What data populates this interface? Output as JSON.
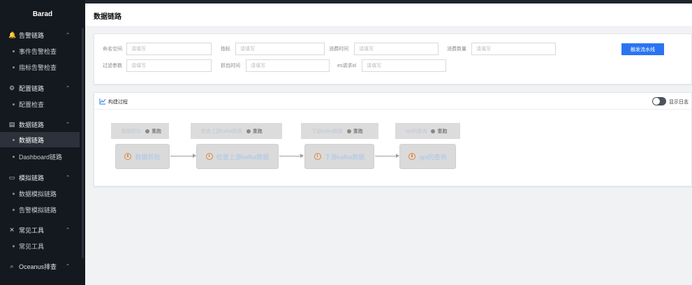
{
  "brand": "Barad",
  "sidebar": {
    "groups": [
      {
        "icon": "bell-icon",
        "glyph": "🔔",
        "label": "告警链路",
        "items": [
          "事件告警检查",
          "指标告警检查"
        ]
      },
      {
        "icon": "sliders-icon",
        "glyph": "⚙",
        "label": "配置链路",
        "items": [
          "配置检查"
        ]
      },
      {
        "icon": "document-icon",
        "glyph": "▤",
        "label": "数据链路",
        "items": [
          "数据链路",
          "Dashboard链路"
        ]
      },
      {
        "icon": "monitor-icon",
        "glyph": "▭",
        "label": "模拟链路",
        "items": [
          "数据模拟链路",
          "告警模拟链路"
        ]
      },
      {
        "icon": "tools-icon",
        "glyph": "✕",
        "label": "常见工具",
        "items": [
          "常见工具"
        ]
      },
      {
        "icon": "search-icon",
        "glyph": "⌕",
        "label": "Oceanus排查",
        "items": []
      }
    ],
    "active_item": "数据链路"
  },
  "page_title": "数据链路",
  "filters": {
    "namespace": {
      "label": "命名空间",
      "placeholder": "请填写"
    },
    "metric": {
      "label": "指标",
      "placeholder": "请填写"
    },
    "consume_time": {
      "label": "消费时间",
      "placeholder": "请填写"
    },
    "consume_count": {
      "label": "消费数量",
      "placeholder": "请填写"
    },
    "filter_params": {
      "label": "过滤参数",
      "placeholder": "请填写"
    },
    "capture_time": {
      "label": "抓包时间",
      "placeholder": "请填写"
    },
    "es_request_id": {
      "label": "es请求id",
      "placeholder": "请填写"
    },
    "trigger_button": "触发流水线"
  },
  "build": {
    "title": "构建过程",
    "toggle_label": "显示日志",
    "toggle_on": false,
    "stages": [
      {
        "status_name": "数据抓包",
        "status_text": "重跑",
        "node_label": "数据抓包"
      },
      {
        "status_name": "检查上游kafka数据",
        "status_text": "重跑",
        "node_label": "检查上游kafka数据"
      },
      {
        "status_name": "下游kafka数据",
        "status_text": "重跑",
        "node_label": "下游kafka数据"
      },
      {
        "status_name": "api的查询",
        "status_text": "重跑",
        "node_label": "api的查询"
      }
    ]
  }
}
